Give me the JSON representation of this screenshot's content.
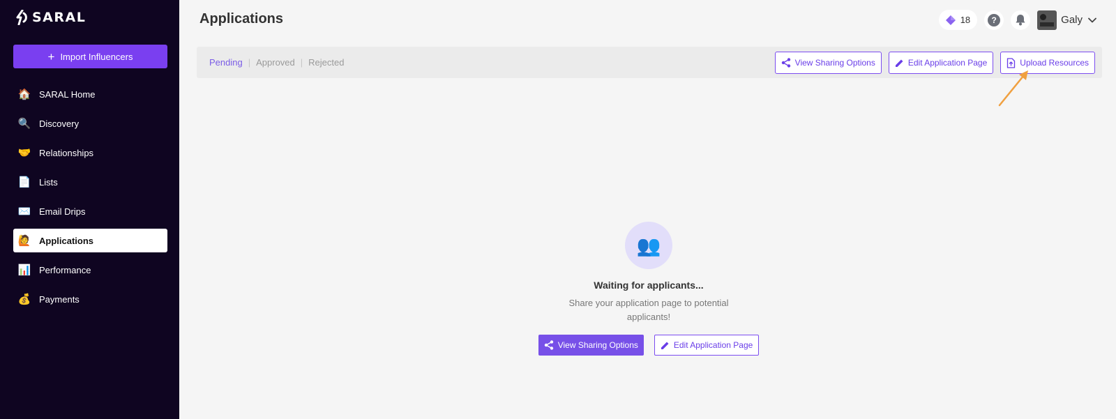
{
  "brand": {
    "name": "SARAL"
  },
  "sidebar": {
    "import_button": {
      "icon": "plus-icon",
      "label": "Import Influencers"
    },
    "items": [
      {
        "icon": "house-icon",
        "label": "SARAL Home",
        "active": false
      },
      {
        "icon": "magnifier-icon",
        "label": "Discovery",
        "active": false
      },
      {
        "icon": "handshake-icon",
        "label": "Relationships",
        "active": false
      },
      {
        "icon": "document-icon",
        "label": "Lists",
        "active": false
      },
      {
        "icon": "envelope-icon",
        "label": "Email Drips",
        "active": false
      },
      {
        "icon": "applicant-icon",
        "label": "Applications",
        "active": true
      },
      {
        "icon": "bar-chart-icon",
        "label": "Performance",
        "active": false
      },
      {
        "icon": "money-bag-icon",
        "label": "Payments",
        "active": false
      }
    ]
  },
  "header": {
    "title": "Applications",
    "credits": "18",
    "user_name": "Galy"
  },
  "tabs": [
    {
      "label": "Pending",
      "active": true
    },
    {
      "label": "Approved",
      "active": false
    },
    {
      "label": "Rejected",
      "active": false
    }
  ],
  "toolbar": {
    "view_sharing": "View Sharing Options",
    "edit_page": "Edit Application Page",
    "upload_resources": "Upload Resources"
  },
  "empty_state": {
    "icon": "busts-icon",
    "title": "Waiting for applicants...",
    "subtitle": "Share your application page to potential applicants!",
    "primary_button": "View Sharing Options",
    "secondary_button": "Edit Application Page"
  },
  "colors": {
    "sidebar_bg": "#0f0521",
    "accent": "#7a3ff0",
    "annotation_arrow": "#f0a040"
  }
}
